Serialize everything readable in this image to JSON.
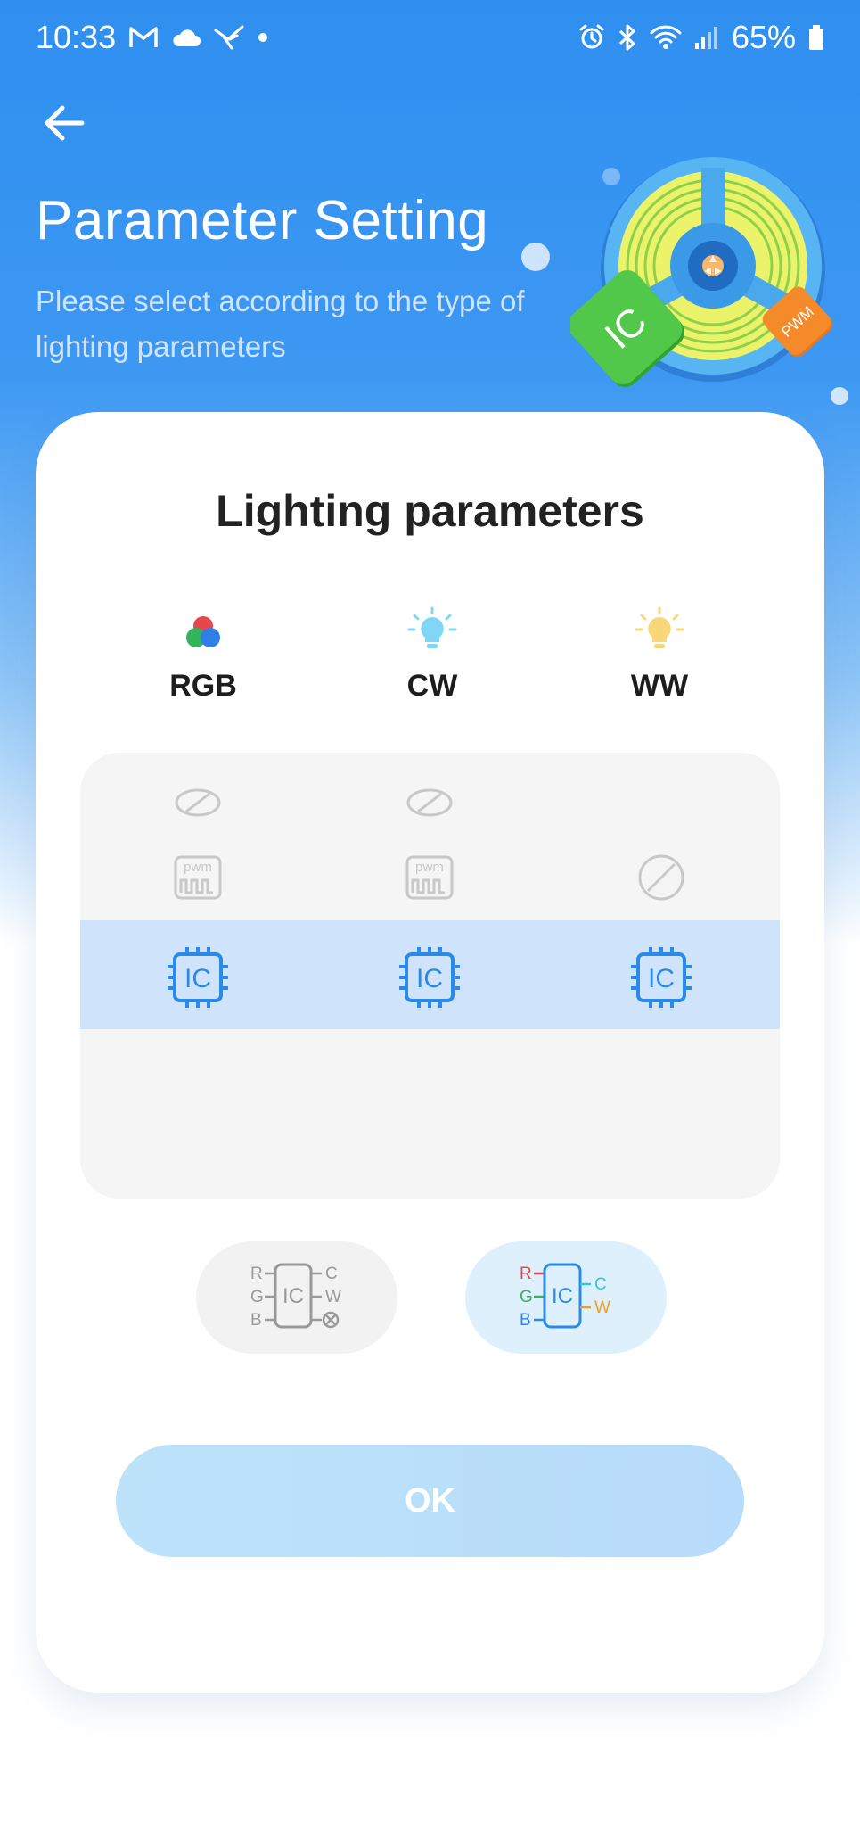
{
  "status_bar": {
    "time": "10:33",
    "battery": "65%",
    "left_icons": [
      "gmail-icon",
      "cloud-icon",
      "bird-icon",
      "dot-icon"
    ],
    "right_icons": [
      "alarm-icon",
      "bluetooth-icon",
      "wifi-icon",
      "signal-icon",
      "battery-icon"
    ]
  },
  "header": {
    "title": "Parameter Setting",
    "subtitle": "Please select according to the type of lighting parameters",
    "hero_ic": "IC",
    "hero_pwm": "PWM"
  },
  "card": {
    "title": "Lighting parameters",
    "types": [
      {
        "label": "RGB",
        "icon": "rgb-circles-icon"
      },
      {
        "label": "CW",
        "icon": "cool-bulb-icon"
      },
      {
        "label": "WW",
        "icon": "warm-bulb-icon"
      }
    ],
    "picker_columns": [
      {
        "options": [
          "none",
          "pwm",
          "IC"
        ],
        "selected": "IC"
      },
      {
        "options": [
          "none",
          "pwm",
          "IC"
        ],
        "selected": "IC"
      },
      {
        "options": [
          "none",
          "IC"
        ],
        "selected": "IC"
      }
    ],
    "ic_label": "IC",
    "pwm_label": "pwm",
    "wiring_options": [
      {
        "inputs": [
          "R",
          "G",
          "B"
        ],
        "outputs": [
          "C",
          "W"
        ],
        "chip": "IC",
        "selected": false
      },
      {
        "inputs": [
          "R",
          "G",
          "B"
        ],
        "outputs": [
          "C",
          "W"
        ],
        "chip": "IC",
        "selected": true
      }
    ],
    "ok_label": "OK"
  },
  "colors": {
    "primary_blue": "#2f8ff0",
    "selection_blue": "#cfe4fa",
    "ic_blue": "#2a8ae8",
    "disabled_gray": "#b8b8b8",
    "red": "#e8454d",
    "green": "#33b35a",
    "cyan": "#2cc8e6",
    "amber": "#f0a020"
  }
}
